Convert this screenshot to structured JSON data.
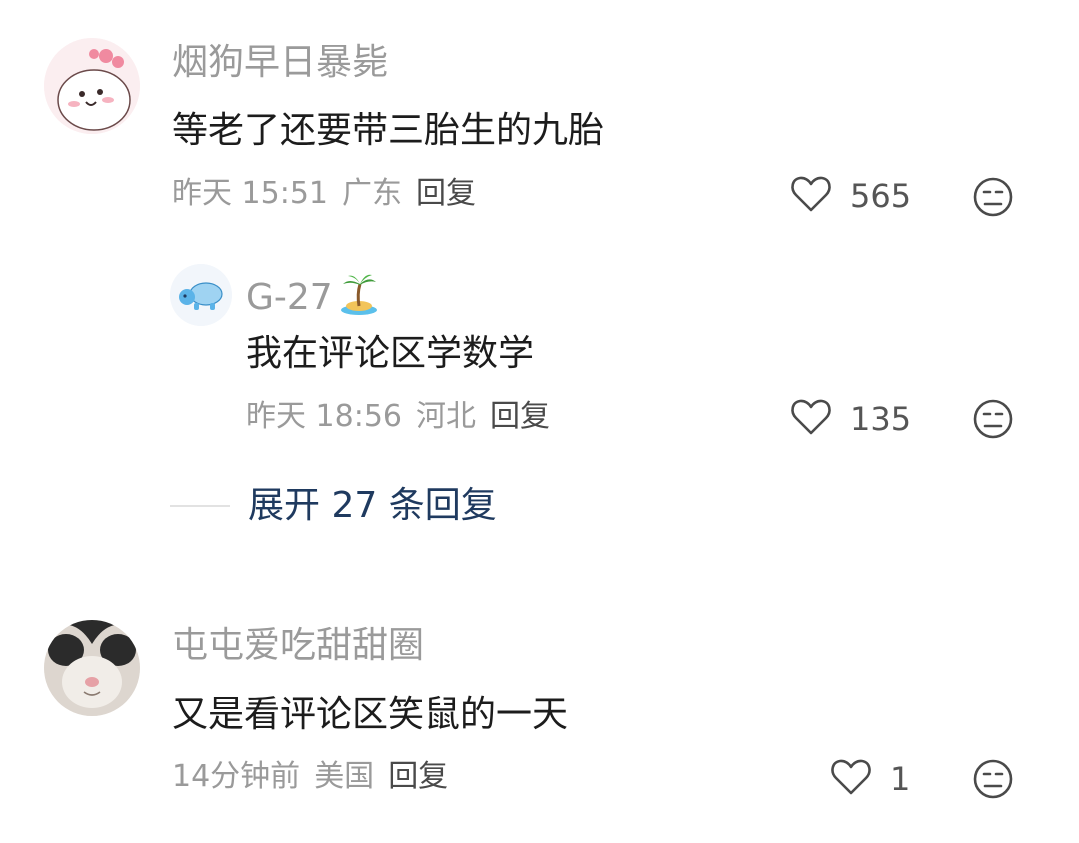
{
  "comments": [
    {
      "username": "烟狗早日暴毙",
      "content": "等老了还要带三胎生的九胎",
      "time": "昨天 15:51",
      "location": "广东",
      "reply_label": "回复",
      "likes": "565"
    },
    {
      "username": "G-27",
      "username_emoji": "🏝",
      "content": "我在评论区学数学",
      "time": "昨天 18:56",
      "location": "河北",
      "reply_label": "回复",
      "likes": "135"
    },
    {
      "username": "屯屯爱吃甜甜圈",
      "content": "又是看评论区笑鼠的一天",
      "time": "14分钟前",
      "location": "美国",
      "reply_label": "回复",
      "likes": "1"
    }
  ],
  "expand": {
    "label": "展开 27 条回复"
  },
  "colors": {
    "username": "#9a9a9a",
    "content": "#1c1c1c",
    "meta": "#9a9a9a",
    "expand_link": "#1f3a5f"
  },
  "icons": {
    "like": "heart-outline-icon",
    "dislike": "unamused-face-icon"
  }
}
